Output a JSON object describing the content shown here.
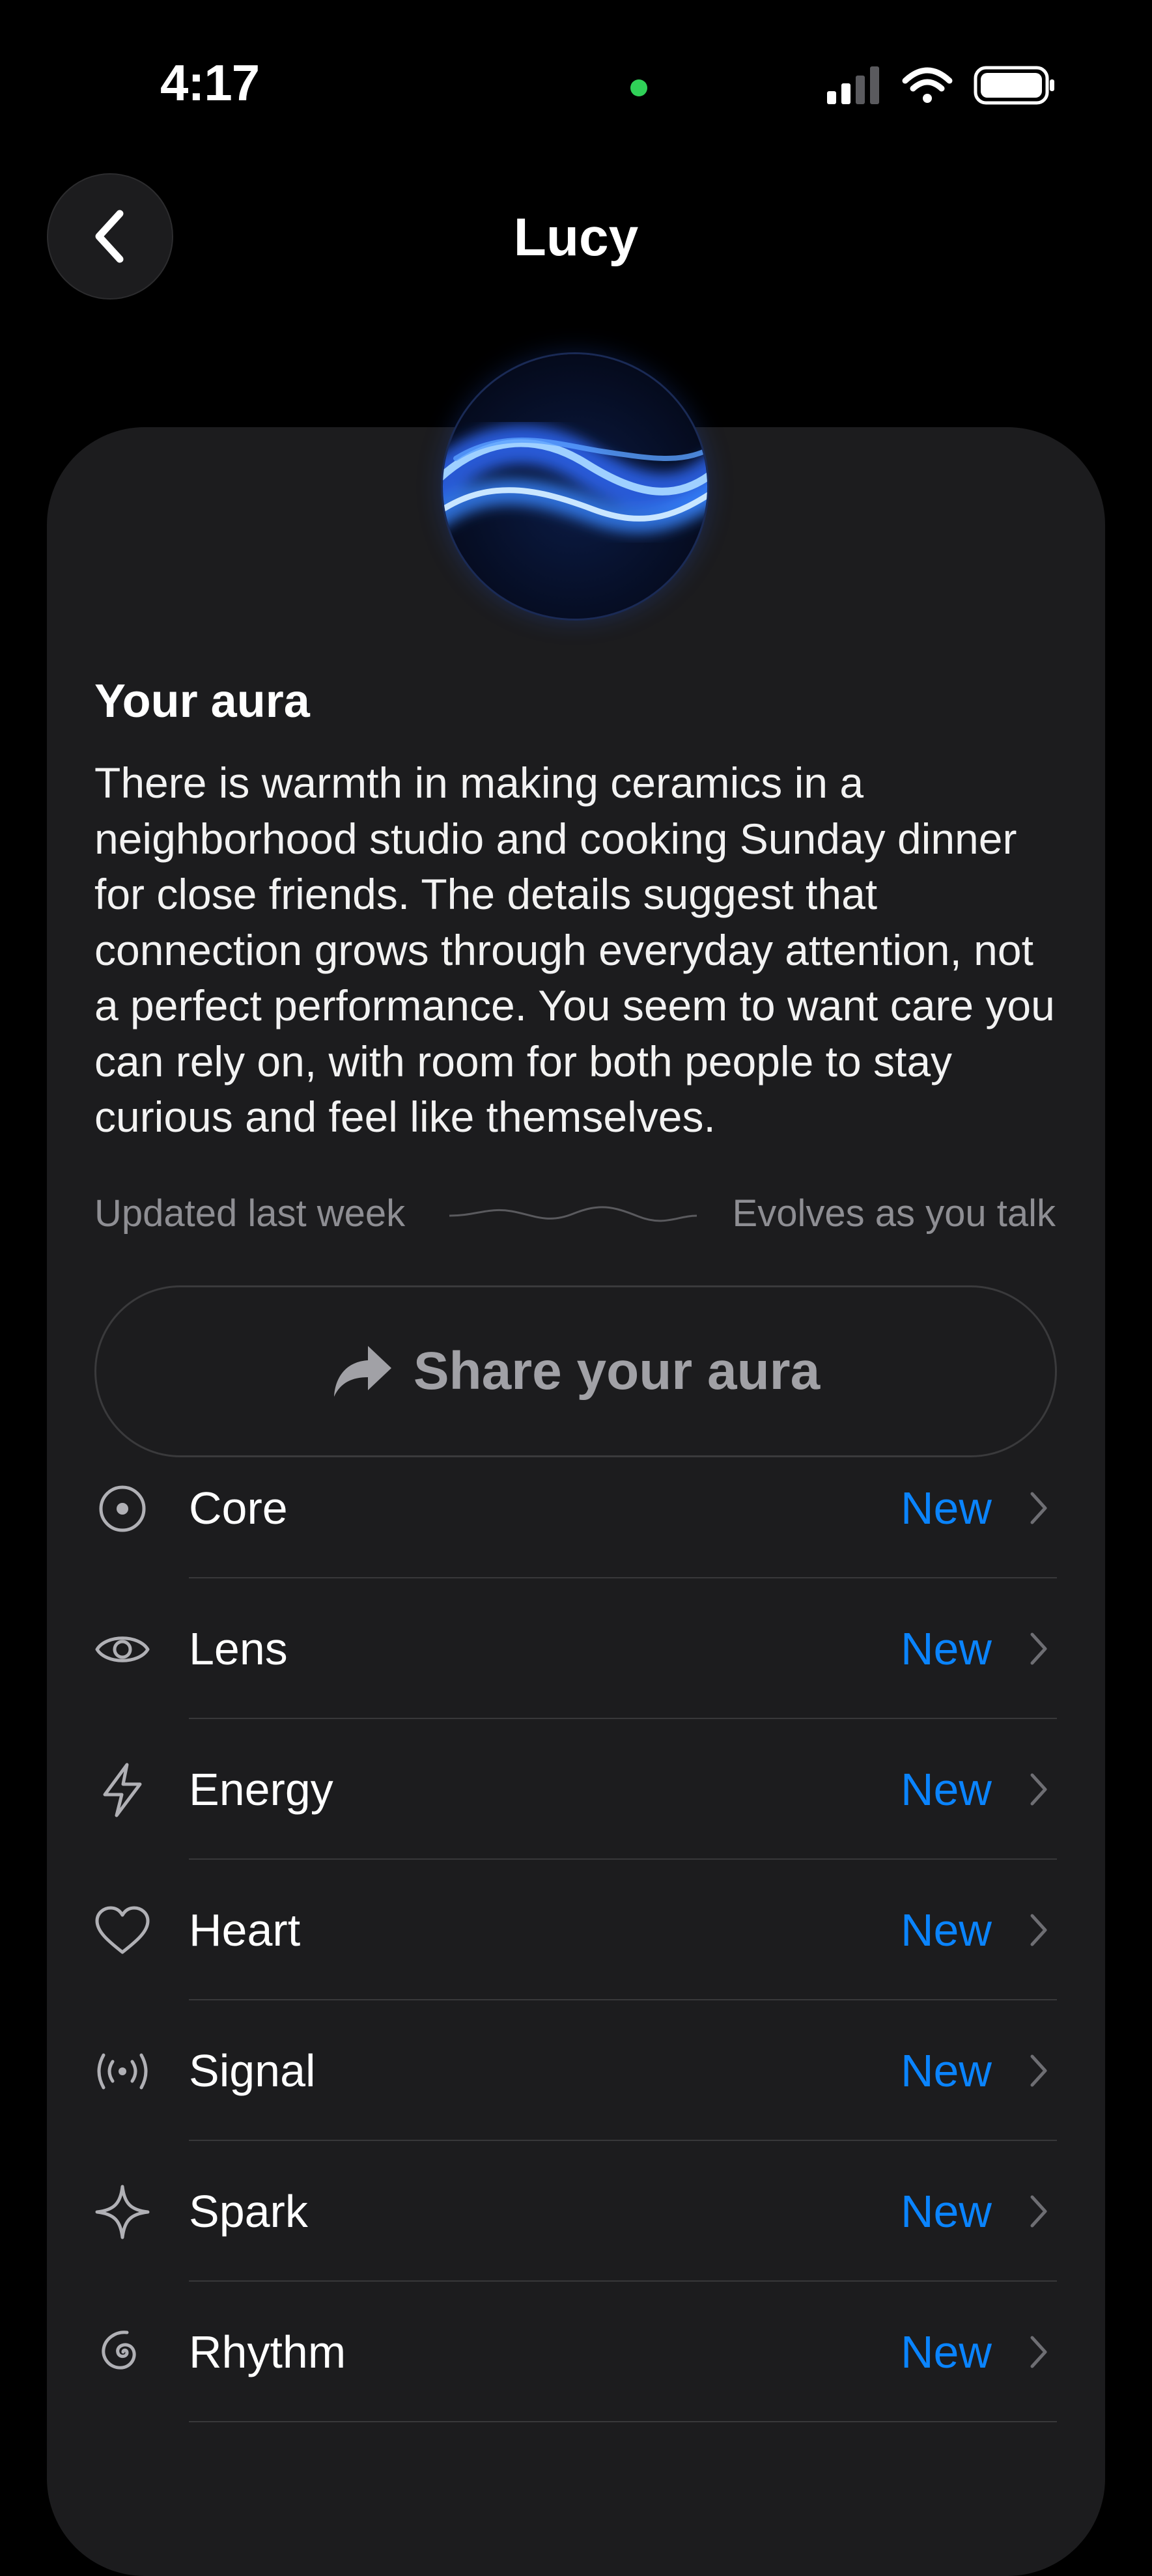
{
  "status_bar": {
    "time": "4:17",
    "icons": [
      "signal-bars-icon",
      "wifi-icon",
      "battery-icon"
    ],
    "indicator_color": "#30d158"
  },
  "nav": {
    "back_icon": "chevron-left-icon",
    "title": "Lucy"
  },
  "aura": {
    "title": "Your aura",
    "description": "There is warmth in making ceramics in a neighborhood studio and cooking Sunday dinner for close friends. The details suggest that connection grows through everyday attention, not a perfect performance. You seem to want care you can rely on, with room for both people to stay curious and feel like themselves.",
    "updated": "Updated last week",
    "evolves": "Evolves as you talk"
  },
  "share": {
    "label": "Share your aura",
    "icon": "share-arrow-icon"
  },
  "sections": [
    {
      "label": "Core",
      "badge": "New",
      "icon": "target-icon"
    },
    {
      "label": "Lens",
      "badge": "New",
      "icon": "eye-icon"
    },
    {
      "label": "Energy",
      "badge": "New",
      "icon": "lightning-icon"
    },
    {
      "label": "Heart",
      "badge": "New",
      "icon": "heart-icon"
    },
    {
      "label": "Signal",
      "badge": "New",
      "icon": "signal-waves-icon"
    },
    {
      "label": "Spark",
      "badge": "New",
      "icon": "sparkle-icon"
    },
    {
      "label": "Rhythm",
      "badge": "New",
      "icon": "spiral-icon"
    }
  ],
  "colors": {
    "accent": "#0a84ff",
    "card": "#1c1c1e",
    "background": "#000000"
  }
}
